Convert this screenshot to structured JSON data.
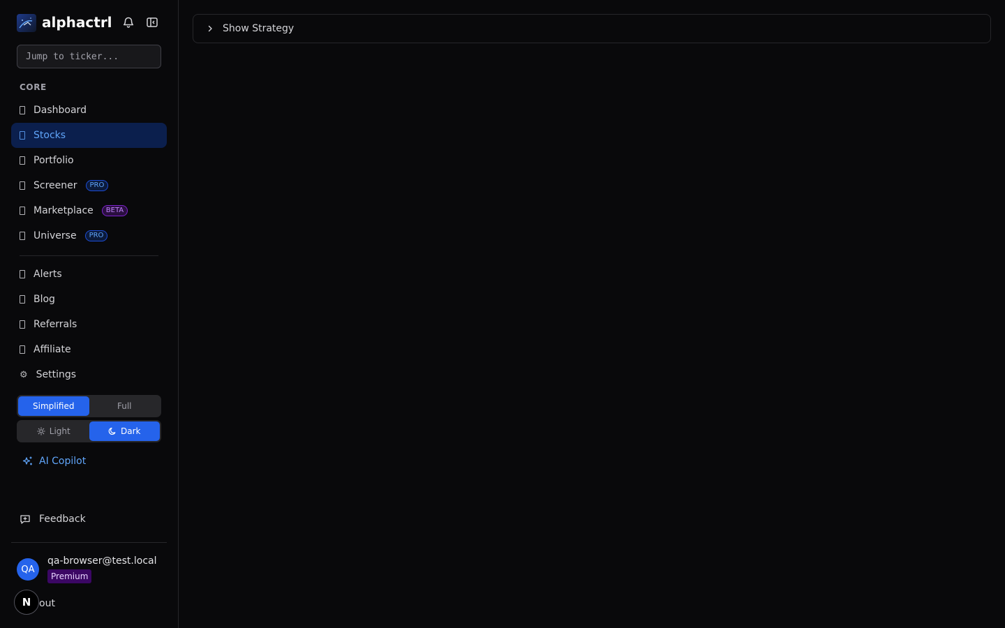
{
  "brand": {
    "name": "alphactrl"
  },
  "search": {
    "placeholder": "Jump to ticker..."
  },
  "sidebar": {
    "section_core": "CORE",
    "core_items": [
      {
        "label": "Dashboard"
      },
      {
        "label": "Stocks",
        "active": true
      },
      {
        "label": "Portfolio"
      },
      {
        "label": "Screener",
        "badge": "PRO"
      },
      {
        "label": "Marketplace",
        "badge": "BETA"
      },
      {
        "label": "Universe",
        "badge": "PRO"
      }
    ],
    "other_items": [
      {
        "label": "Alerts"
      },
      {
        "label": "Blog"
      },
      {
        "label": "Referrals"
      },
      {
        "label": "Affiliate"
      },
      {
        "label": "Settings"
      }
    ]
  },
  "view_mode": {
    "options": [
      "Simplified",
      "Full"
    ],
    "selected": "Simplified"
  },
  "theme": {
    "options": [
      "Light",
      "Dark"
    ],
    "selected": "Dark"
  },
  "copilot": {
    "label": "AI Copilot"
  },
  "feedback": {
    "label": "Feedback"
  },
  "user": {
    "initials": "QA",
    "email": "qa-browser@test.local",
    "plan": "Premium",
    "signout_label": "out"
  },
  "n_badge": {
    "label": "N"
  },
  "main": {
    "strategy_toggle": "Show Strategy"
  },
  "colors": {
    "background": "#09090b",
    "accent": "#2563eb",
    "active_nav_bg": "#0b1f4d",
    "link": "#60a5fa",
    "premium": "#3b0764"
  }
}
